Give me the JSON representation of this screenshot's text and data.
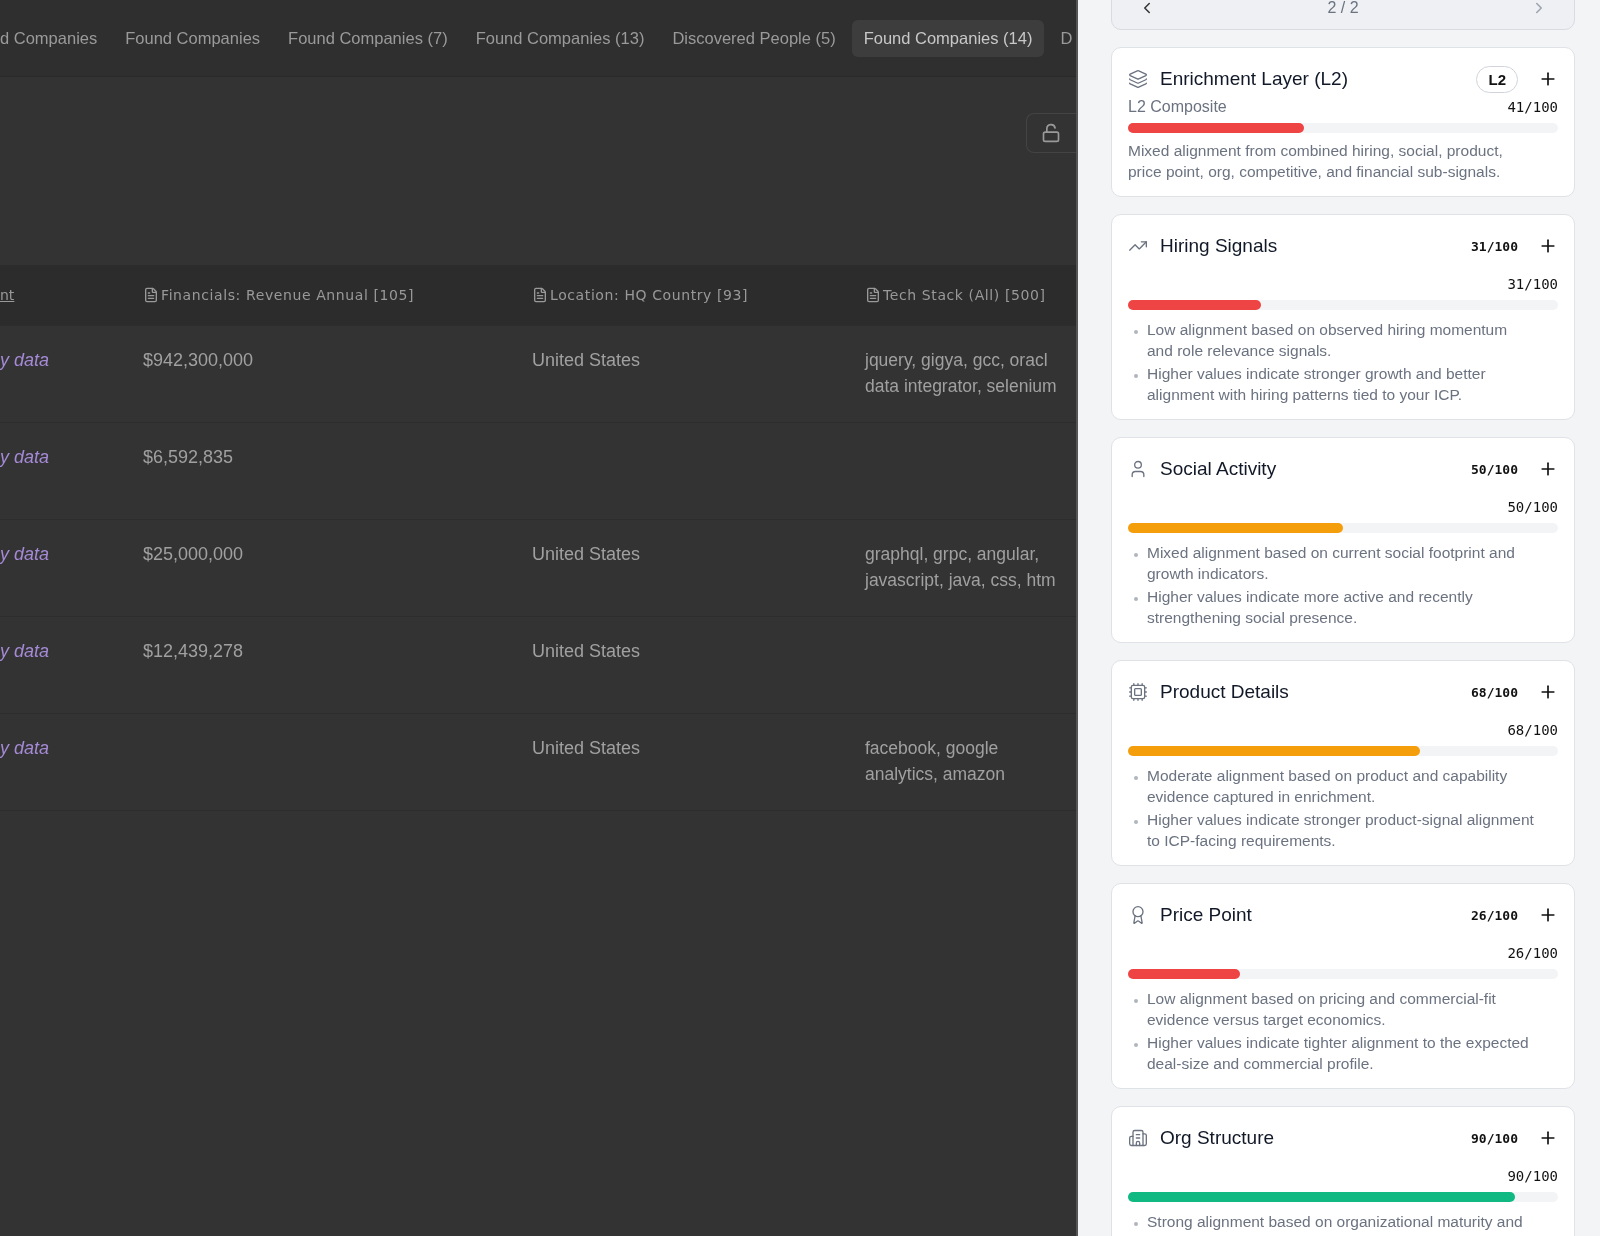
{
  "tabs": [
    {
      "label": "d Companies",
      "selected": false
    },
    {
      "label": "Found Companies",
      "selected": false
    },
    {
      "label": "Found Companies (7)",
      "selected": false
    },
    {
      "label": "Found Companies (13)",
      "selected": false
    },
    {
      "label": "Discovered People (5)",
      "selected": false
    },
    {
      "label": "Found Companies (14)",
      "selected": true
    },
    {
      "label": "D",
      "selected": false
    }
  ],
  "table": {
    "columns": [
      "nt",
      "Financials: Revenue Annual [105]",
      "Location: HQ Country [93]",
      "Tech Stack (All) [500]"
    ],
    "rows": [
      [
        "y data",
        "$942,300,000",
        "United States",
        [
          "jquery, gigya, gcc, oracl",
          "data integrator, selenium"
        ]
      ],
      [
        "y data",
        "$6,592,835",
        "",
        []
      ],
      [
        "y data",
        "$25,000,000",
        "United States",
        [
          "graphql, grpc, angular,",
          "javascript, java, css, htm"
        ]
      ],
      [
        "y data",
        "$12,439,278",
        "United States",
        []
      ],
      [
        "y data",
        "",
        "United States",
        [
          "facebook, google",
          "analytics, amazon"
        ]
      ]
    ]
  },
  "drawer": {
    "pager": "2 / 2",
    "sections": [
      {
        "kind": "layer",
        "title": "Enrichment Layer (L2)",
        "badge": "L2",
        "label": "L2 Composite",
        "score": "41/100",
        "level": 0.41,
        "description": "Mixed alignment from combined hiring, social, product, price point, org, competitive, and financial sub-signals."
      },
      {
        "kind": "signal",
        "title": "Hiring Signals",
        "header_score": "31/100",
        "score": "31/100",
        "level": 0.31,
        "bullets": [
          "Low alignment based on observed hiring momentum and role relevance signals.",
          "Higher values indicate stronger growth and better alignment with hiring patterns tied to your ICP."
        ]
      },
      {
        "kind": "signal",
        "title": "Social Activity",
        "header_score": "50/100",
        "score": "50/100",
        "level": 0.5,
        "bullets": [
          "Mixed alignment based on current social footprint and growth indicators.",
          "Higher values indicate more active and recently strengthening social presence."
        ]
      },
      {
        "kind": "signal",
        "title": "Product Details",
        "header_score": "68/100",
        "score": "68/100",
        "level": 0.68,
        "bullets": [
          "Moderate alignment based on product and capability evidence captured in enrichment.",
          "Higher values indicate stronger product-signal alignment to ICP-facing requirements."
        ]
      },
      {
        "kind": "signal",
        "title": "Price Point",
        "header_score": "26/100",
        "score": "26/100",
        "level": 0.26,
        "bullets": [
          "Low alignment based on pricing and commercial-fit evidence versus target economics.",
          "Higher values indicate tighter alignment to the expected deal-size and commercial profile."
        ]
      },
      {
        "kind": "signal",
        "title": "Org Structure",
        "header_score": "90/100",
        "score": "90/100",
        "level": 0.9,
        "bullets": [
          "Strong alignment based on organizational maturity and"
        ]
      }
    ]
  }
}
